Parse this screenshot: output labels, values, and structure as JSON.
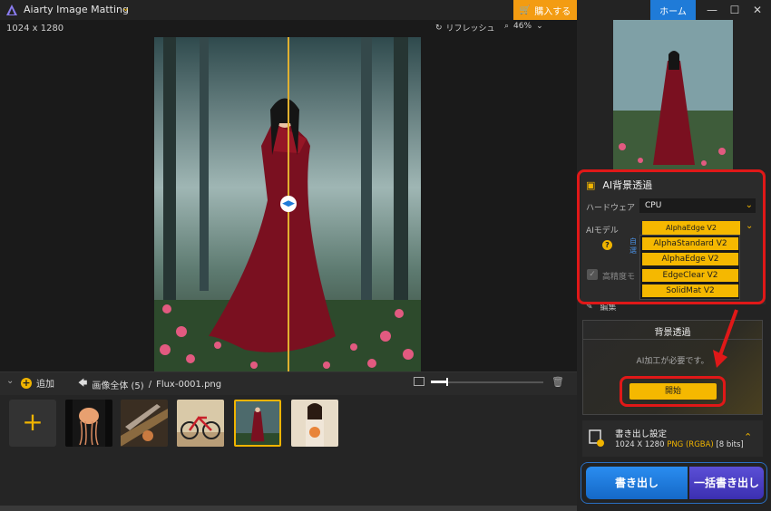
{
  "app": {
    "title": "Aiarty Image Matting",
    "buy": "購入する",
    "home": "ホーム"
  },
  "window": {
    "minimize_icon": "minimize-icon",
    "maximize_icon": "maximize-icon",
    "close_icon": "close-icon"
  },
  "canvas": {
    "dims": "1024 x 1280",
    "refresh": "リフレッシュ",
    "zoom": "46%"
  },
  "thumbbar": {
    "add": "追加",
    "breadcrumb_root": "画像全体 (5)",
    "separator": "/",
    "filename": "Flux-0001.png",
    "selected_index": 3
  },
  "panel": {
    "ai_title": "AI背景透過",
    "hardware_label": "ハードウェア",
    "hardware_value": "CPU",
    "model_label": "AIモデル",
    "model_value": "AlphaEdge  V2",
    "model_options": [
      "AlphaStandard  V2",
      "AlphaEdge  V2",
      "EdgeClear  V2",
      "SolidMat  V2"
    ],
    "obscured_link": "自\n選",
    "hq_label": "高精度モ",
    "edit_label": "編集",
    "bg_title": "背景透過",
    "bg_message": "AI加工が必要です。",
    "start": "開始",
    "export_title": "書き出し設定",
    "export_dims": "1024 X 1280",
    "export_format": "PNG (RGBA)",
    "export_bits": "[8 bits]",
    "export": "書き出し",
    "batch_export": "一括書き出し"
  },
  "colors": {
    "accent": "#f5b800",
    "highlight": "#e01818",
    "primary": "#1f7bd8"
  }
}
